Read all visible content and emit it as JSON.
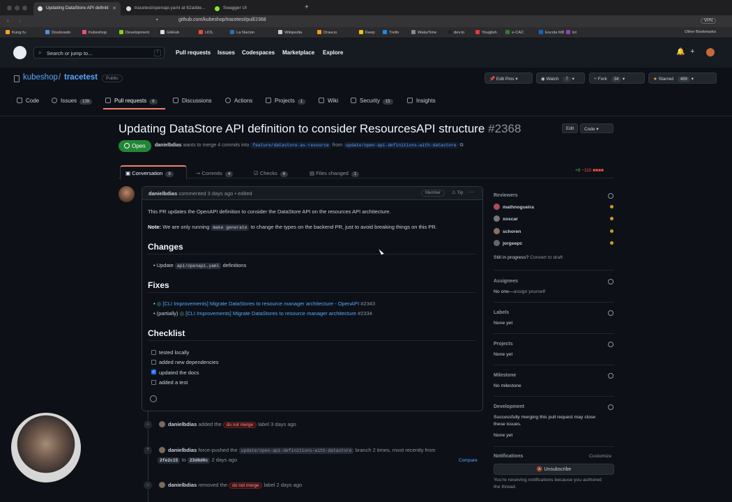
{
  "browser": {
    "tabs": [
      "Updating DataStore API definiti",
      "tracetest/openapi.yaml at 62adde...",
      "Swagger UI"
    ],
    "url": "github.com/kubeshop/tracetest/pull/2368",
    "bookmarks": [
      "Kung fu",
      "Doutorado",
      "Kubeshop",
      "Development",
      "GitHub",
      "UOL",
      "La Nacion",
      "Wikipedia",
      "Draw.io",
      "Keep",
      "Trello",
      "WakaTime",
      "dev.to",
      "Youglish",
      "e-CAC",
      "Escola M8",
      "lol"
    ],
    "other_bookmarks": "Other Bookmarks",
    "vpn": "VPN"
  },
  "github": {
    "search_placeholder": "Search or jump to...",
    "search_key": "/",
    "nav": [
      "Pull requests",
      "Issues",
      "Codespaces",
      "Marketplace",
      "Explore"
    ]
  },
  "repo": {
    "owner": "kubeshop",
    "sep": "/",
    "name": "tracetest",
    "visibility": "Public",
    "buttons": {
      "edit_pins": "Edit Pins",
      "watch": "Watch",
      "watch_count": "7",
      "fork": "Fork",
      "fork_count": "34",
      "starred": "Starred",
      "star_count": "489"
    },
    "tabs": [
      {
        "label": "Code",
        "count": ""
      },
      {
        "label": "Issues",
        "count": "139"
      },
      {
        "label": "Pull requests",
        "count": "6"
      },
      {
        "label": "Discussions",
        "count": ""
      },
      {
        "label": "Actions",
        "count": ""
      },
      {
        "label": "Projects",
        "count": "1"
      },
      {
        "label": "Wiki",
        "count": ""
      },
      {
        "label": "Security",
        "count": "15"
      },
      {
        "label": "Insights",
        "count": ""
      }
    ]
  },
  "pr": {
    "title": "Updating DataStore API definition to consider ResourcesAPI structure",
    "number": "#2368",
    "edit": "Edit",
    "code": "Code",
    "status": "Open",
    "author": "danielbdias",
    "meta_mid": "wants to merge 4 commits into",
    "base": "feature/datastore-as-resource",
    "meta_from": "from",
    "head": "update/open-api-definitions-with-datastore",
    "tabs": [
      {
        "label": "Conversation",
        "count": "9"
      },
      {
        "label": "Commits",
        "count": "4"
      },
      {
        "label": "Checks",
        "count": "6"
      },
      {
        "label": "Files changed",
        "count": "1"
      }
    ],
    "additions": "+8",
    "deletions": "−110"
  },
  "comment": {
    "author": "danielbdias",
    "meta": "commented 3 days ago",
    "edited": "• edited",
    "role": "Member",
    "tip": "Tip",
    "intro": "This PR updates the OpenAPI definition to consider the DataStore API on the resources API architecture.",
    "note_label": "Note:",
    "note_a": "We are only running",
    "note_code": "make generate",
    "note_b": "to change the types on the backend PR, just to avoid breaking things on this PR.",
    "changes_title": "Changes",
    "change_a": "Update",
    "change_code": "api/openapi.yaml",
    "change_b": "definitions",
    "fixes_title": "Fixes",
    "fix1_link": "[CLI Improvements] Migrate DataStores to resource manager architecture - OpenAPI",
    "fix1_num": "#2343",
    "fix2_prefix": "(partially)",
    "fix2_link": "[CLI Improvements] Migrate DataStores to resource manager architecture",
    "fix2_num": "#2334",
    "checklist_title": "Checklist",
    "checklist": [
      {
        "label": "tested locally",
        "checked": false
      },
      {
        "label": "added new dependencies",
        "checked": false
      },
      {
        "label": "updated the docs",
        "checked": true
      },
      {
        "label": "added a test",
        "checked": false
      }
    ]
  },
  "sidebar": {
    "reviewers_title": "Reviewers",
    "reviewers": [
      "mathnogueira",
      "xoscar",
      "schoren",
      "jorgeepc"
    ],
    "in_progress": "Still in progress?",
    "convert": "Convert to draft",
    "assignees_title": "Assignees",
    "assignees_value": "No one—",
    "assign_self": "assign yourself",
    "labels_title": "Labels",
    "labels_value": "None yet",
    "projects_title": "Projects",
    "projects_value": "None yet",
    "milestone_title": "Milestone",
    "milestone_value": "No milestone",
    "development_title": "Development",
    "development_text1": "Successfully merging this pull request may close",
    "development_text2": "these issues.",
    "development_value": "None yet",
    "notifications_title": "Notifications",
    "customize": "Customize",
    "unsubscribe": "Unsubscribe",
    "notif_text1": "You're receiving notifications because you authored",
    "notif_text2": "the thread."
  },
  "timeline": {
    "e1_author": "danielbdias",
    "e1_a": "added the",
    "e1_label": "do not merge",
    "e1_b": "label 3 days ago",
    "e2_author": "danielbdias",
    "e2_a": "force-pushed the",
    "e2_branch": "update/open-api-definitions-with-datastore",
    "e2_b": "branch 2 times, most recently from",
    "e2_from": "2fe2c15",
    "e2_to_word": "to",
    "e2_to": "23d6d0c",
    "e2_time": "2 days ago",
    "e2_compare": "Compare",
    "e3_author": "danielbdias",
    "e3_a": "removed the",
    "e3_label": "do not merge",
    "e3_b": "label 2 days ago"
  },
  "colors": {
    "accent": "#58a6ff",
    "open": "#238636",
    "bg": "#0d1117"
  }
}
